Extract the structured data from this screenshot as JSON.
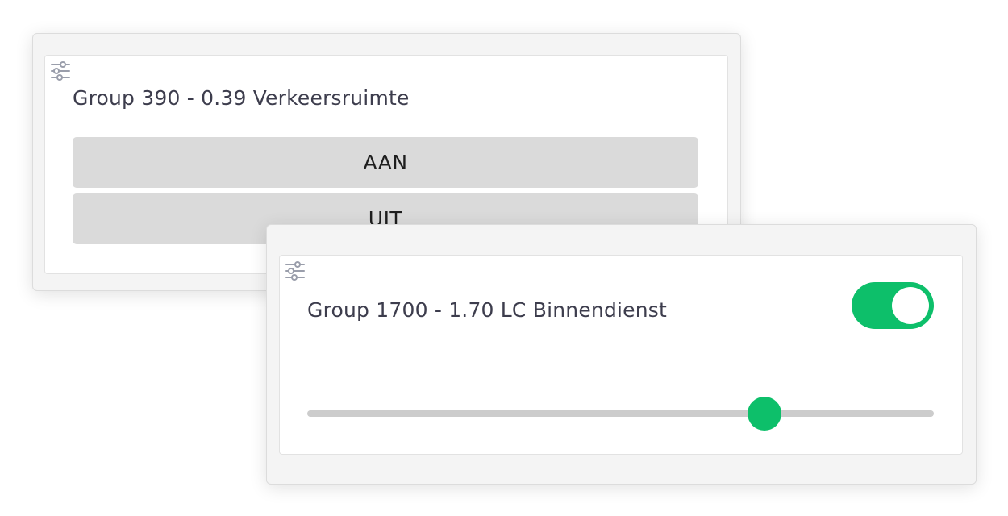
{
  "colors": {
    "accent": "#0dbf6a",
    "button_bg": "#dadada",
    "track": "#cccccc",
    "card_outer": "#f4f4f4",
    "icon": "#9a9eab"
  },
  "card1": {
    "icon": "sliders-icon",
    "title": "Group 390 - 0.39 Verkeersruimte",
    "on_label": "AAN",
    "off_label": "UIT"
  },
  "card2": {
    "icon": "sliders-icon",
    "title": "Group 1700 - 1.70 LC Binnendienst",
    "toggle_on": true,
    "slider_fraction": 0.73
  }
}
